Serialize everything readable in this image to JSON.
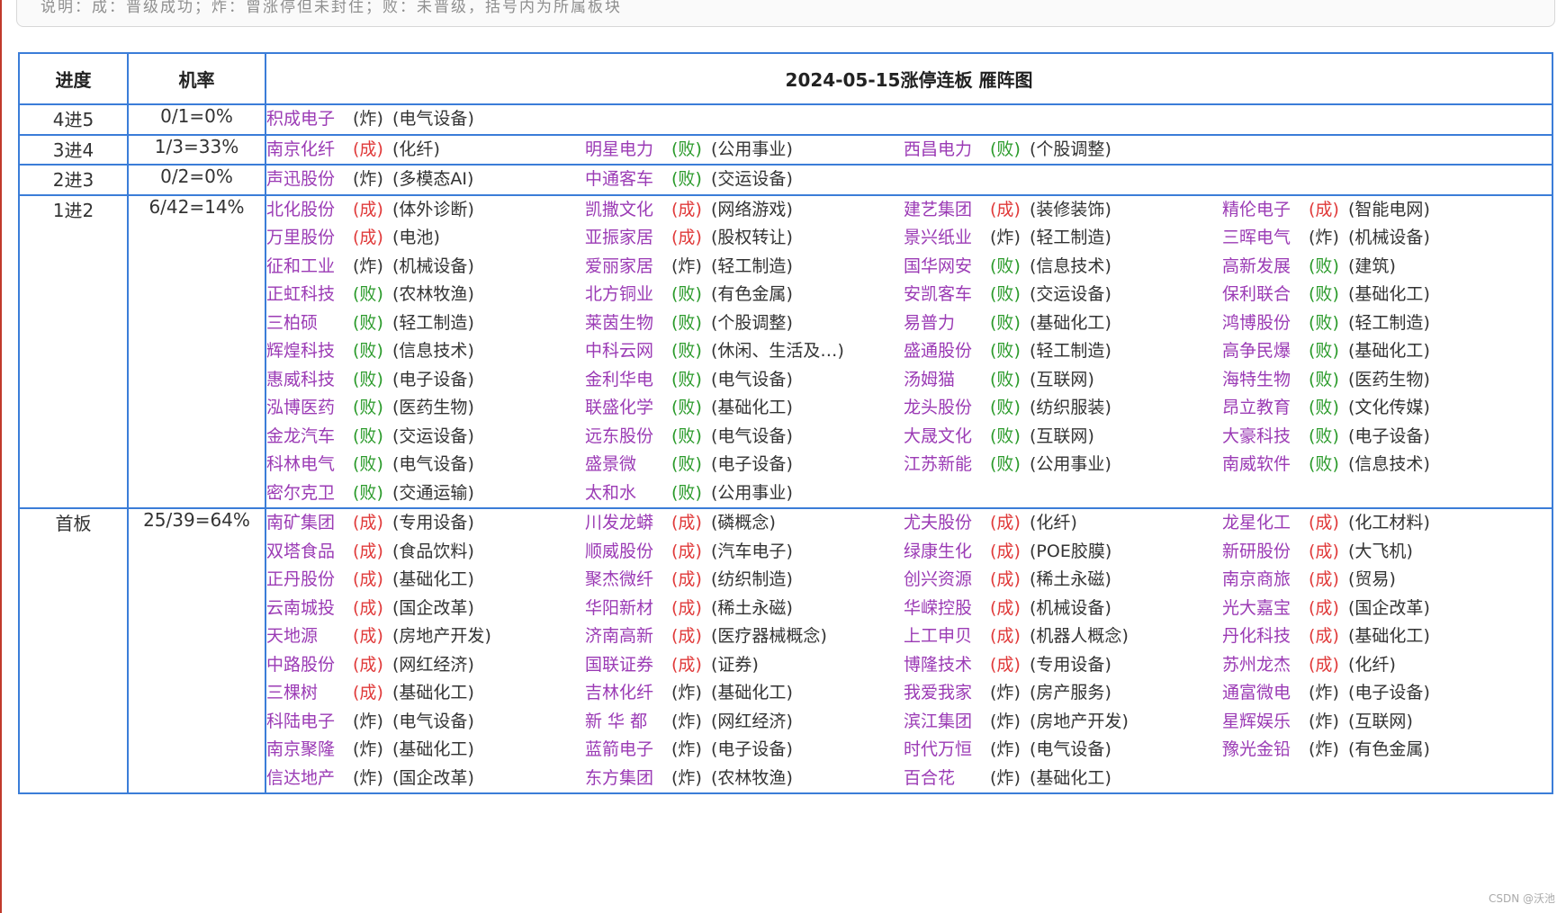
{
  "top_note": "说明：成：晋级成功；炸：曾涨停但未封住；败：未晋级，括号内为所属板块",
  "table": {
    "headers": {
      "progress": "进度",
      "rate": "机率",
      "title": "2024-05-15涨停连板 雁阵图"
    },
    "status_colors": {
      "成": "#e03a3a",
      "败": "#2a9a2a",
      "炸": "#333333"
    },
    "rows": [
      {
        "progress": "4进5",
        "rate": "0/1=0%",
        "stocks": [
          {
            "name": "积成电子",
            "result": "炸",
            "sector": "电气设备"
          }
        ]
      },
      {
        "progress": "3进4",
        "rate": "1/3=33%",
        "stocks": [
          {
            "name": "南京化纤",
            "result": "成",
            "sector": "化纤"
          },
          {
            "name": "明星电力",
            "result": "败",
            "sector": "公用事业"
          },
          {
            "name": "西昌电力",
            "result": "败",
            "sector": "个股调整"
          }
        ]
      },
      {
        "progress": "2进3",
        "rate": "0/2=0%",
        "stocks": [
          {
            "name": "声迅股份",
            "result": "炸",
            "sector": "多模态AI"
          },
          {
            "name": "中通客车",
            "result": "败",
            "sector": "交运设备"
          }
        ]
      },
      {
        "progress": "1进2",
        "rate": "6/42=14%",
        "stocks": [
          {
            "name": "北化股份",
            "result": "成",
            "sector": "体外诊断"
          },
          {
            "name": "凯撒文化",
            "result": "成",
            "sector": "网络游戏"
          },
          {
            "name": "建艺集团",
            "result": "成",
            "sector": "装修装饰"
          },
          {
            "name": "精伦电子",
            "result": "成",
            "sector": "智能电网"
          },
          {
            "name": "万里股份",
            "result": "成",
            "sector": "电池"
          },
          {
            "name": "亚振家居",
            "result": "成",
            "sector": "股权转让"
          },
          {
            "name": "景兴纸业",
            "result": "炸",
            "sector": "轻工制造"
          },
          {
            "name": "三晖电气",
            "result": "炸",
            "sector": "机械设备"
          },
          {
            "name": "征和工业",
            "result": "炸",
            "sector": "机械设备"
          },
          {
            "name": "爱丽家居",
            "result": "炸",
            "sector": "轻工制造"
          },
          {
            "name": "国华网安",
            "result": "败",
            "sector": "信息技术"
          },
          {
            "name": "高新发展",
            "result": "败",
            "sector": "建筑"
          },
          {
            "name": "正虹科技",
            "result": "败",
            "sector": "农林牧渔"
          },
          {
            "name": "北方铜业",
            "result": "败",
            "sector": "有色金属"
          },
          {
            "name": "安凯客车",
            "result": "败",
            "sector": "交运设备"
          },
          {
            "name": "保利联合",
            "result": "败",
            "sector": "基础化工"
          },
          {
            "name": "三柏硕",
            "result": "败",
            "sector": "轻工制造"
          },
          {
            "name": "莱茵生物",
            "result": "败",
            "sector": "个股调整"
          },
          {
            "name": "易普力",
            "result": "败",
            "sector": "基础化工"
          },
          {
            "name": "鸿博股份",
            "result": "败",
            "sector": "轻工制造"
          },
          {
            "name": "辉煌科技",
            "result": "败",
            "sector": "信息技术"
          },
          {
            "name": "中科云网",
            "result": "败",
            "sector": "休闲、生活及…"
          },
          {
            "name": "盛通股份",
            "result": "败",
            "sector": "轻工制造"
          },
          {
            "name": "高争民爆",
            "result": "败",
            "sector": "基础化工"
          },
          {
            "name": "惠威科技",
            "result": "败",
            "sector": "电子设备"
          },
          {
            "name": "金利华电",
            "result": "败",
            "sector": "电气设备"
          },
          {
            "name": "汤姆猫",
            "result": "败",
            "sector": "互联网"
          },
          {
            "name": "海特生物",
            "result": "败",
            "sector": "医药生物"
          },
          {
            "name": "泓博医药",
            "result": "败",
            "sector": "医药生物"
          },
          {
            "name": "联盛化学",
            "result": "败",
            "sector": "基础化工"
          },
          {
            "name": "龙头股份",
            "result": "败",
            "sector": "纺织服装"
          },
          {
            "name": "昂立教育",
            "result": "败",
            "sector": "文化传媒"
          },
          {
            "name": "金龙汽车",
            "result": "败",
            "sector": "交运设备"
          },
          {
            "name": "远东股份",
            "result": "败",
            "sector": "电气设备"
          },
          {
            "name": "大晟文化",
            "result": "败",
            "sector": "互联网"
          },
          {
            "name": "大豪科技",
            "result": "败",
            "sector": "电子设备"
          },
          {
            "name": "科林电气",
            "result": "败",
            "sector": "电气设备"
          },
          {
            "name": "盛景微",
            "result": "败",
            "sector": "电子设备"
          },
          {
            "name": "江苏新能",
            "result": "败",
            "sector": "公用事业"
          },
          {
            "name": "南威软件",
            "result": "败",
            "sector": "信息技术"
          },
          {
            "name": "密尔克卫",
            "result": "败",
            "sector": "交通运输"
          },
          {
            "name": "太和水",
            "result": "败",
            "sector": "公用事业"
          }
        ]
      },
      {
        "progress": "首板",
        "rate": "25/39=64%",
        "stocks": [
          {
            "name": "南矿集团",
            "result": "成",
            "sector": "专用设备"
          },
          {
            "name": "川发龙蟒",
            "result": "成",
            "sector": "磷概念"
          },
          {
            "name": "尤夫股份",
            "result": "成",
            "sector": "化纤"
          },
          {
            "name": "龙星化工",
            "result": "成",
            "sector": "化工材料"
          },
          {
            "name": "双塔食品",
            "result": "成",
            "sector": "食品饮料"
          },
          {
            "name": "顺威股份",
            "result": "成",
            "sector": "汽车电子"
          },
          {
            "name": "绿康生化",
            "result": "成",
            "sector": "POE胶膜"
          },
          {
            "name": "新研股份",
            "result": "成",
            "sector": "大飞机"
          },
          {
            "name": "正丹股份",
            "result": "成",
            "sector": "基础化工"
          },
          {
            "name": "聚杰微纤",
            "result": "成",
            "sector": "纺织制造"
          },
          {
            "name": "创兴资源",
            "result": "成",
            "sector": "稀土永磁"
          },
          {
            "name": "南京商旅",
            "result": "成",
            "sector": "贸易"
          },
          {
            "name": "云南城投",
            "result": "成",
            "sector": "国企改革"
          },
          {
            "name": "华阳新材",
            "result": "成",
            "sector": "稀土永磁"
          },
          {
            "name": "华嵘控股",
            "result": "成",
            "sector": "机械设备"
          },
          {
            "name": "光大嘉宝",
            "result": "成",
            "sector": "国企改革"
          },
          {
            "name": "天地源",
            "result": "成",
            "sector": "房地产开发"
          },
          {
            "name": "济南高新",
            "result": "成",
            "sector": "医疗器械概念"
          },
          {
            "name": "上工申贝",
            "result": "成",
            "sector": "机器人概念"
          },
          {
            "name": "丹化科技",
            "result": "成",
            "sector": "基础化工"
          },
          {
            "name": "中路股份",
            "result": "成",
            "sector": "网红经济"
          },
          {
            "name": "国联证券",
            "result": "成",
            "sector": "证券"
          },
          {
            "name": "博隆技术",
            "result": "成",
            "sector": "专用设备"
          },
          {
            "name": "苏州龙杰",
            "result": "成",
            "sector": "化纤"
          },
          {
            "name": "三棵树",
            "result": "成",
            "sector": "基础化工"
          },
          {
            "name": "吉林化纤",
            "result": "炸",
            "sector": "基础化工"
          },
          {
            "name": "我爱我家",
            "result": "炸",
            "sector": "房产服务"
          },
          {
            "name": "通富微电",
            "result": "炸",
            "sector": "电子设备"
          },
          {
            "name": "科陆电子",
            "result": "炸",
            "sector": "电气设备"
          },
          {
            "name": "新 华 都",
            "result": "炸",
            "sector": "网红经济"
          },
          {
            "name": "滨江集团",
            "result": "炸",
            "sector": "房地产开发"
          },
          {
            "name": "星辉娱乐",
            "result": "炸",
            "sector": "互联网"
          },
          {
            "name": "南京聚隆",
            "result": "炸",
            "sector": "基础化工"
          },
          {
            "name": "蓝箭电子",
            "result": "炸",
            "sector": "电子设备"
          },
          {
            "name": "时代万恒",
            "result": "炸",
            "sector": "电气设备"
          },
          {
            "name": "豫光金铅",
            "result": "炸",
            "sector": "有色金属"
          },
          {
            "name": "信达地产",
            "result": "炸",
            "sector": "国企改革"
          },
          {
            "name": "东方集团",
            "result": "炸",
            "sector": "农林牧渔"
          },
          {
            "name": "百合花",
            "result": "炸",
            "sector": "基础化工"
          }
        ]
      }
    ]
  },
  "watermark": "CSDN @沃池"
}
